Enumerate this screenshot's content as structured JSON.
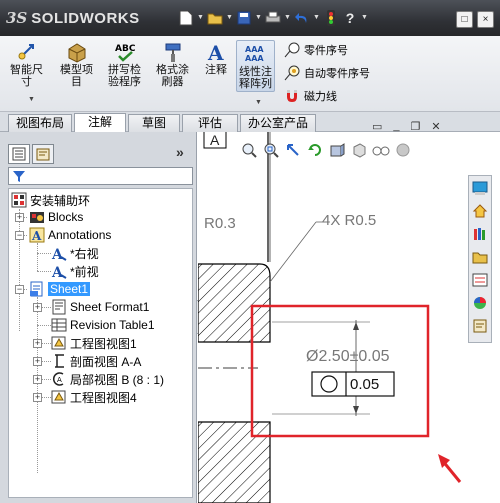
{
  "app": {
    "logo_prefix": "3S",
    "logo_text": "SOLIDWORKS"
  },
  "quick_access": [
    "new-icon",
    "open-icon",
    "save-icon",
    "print-icon",
    "undo-icon",
    "rebuild-icon",
    "help-icon"
  ],
  "window_buttons": [
    "□",
    "×"
  ],
  "ribbon": {
    "smart_dimension": "智能尺\n寸",
    "model_items": "模型项\n目",
    "spell_check": "拼写检\n验程序",
    "format_painter": "格式涂\n刷器",
    "note": "注释",
    "linear_note_pattern": "线性注\n释阵列",
    "balloon": "零件序号",
    "auto_balloon": "自动零件序号",
    "magnetic_line": "磁力线"
  },
  "tabs": [
    "视图布局",
    "注解",
    "草图",
    "评估",
    "办公室产品"
  ],
  "selected_tab": "注解",
  "panel": {
    "chevron": "»",
    "tree": {
      "root": "安装辅助环",
      "blocks": "Blocks",
      "annotations": "Annotations",
      "right_view": "*右视",
      "front_view": "*前视",
      "sheet": "Sheet1",
      "sheet_format": "Sheet Format1",
      "revision_table": "Revision Table1",
      "drawing_view1": "工程图视图1",
      "section_view": "剖面视图 A-A",
      "detail_view": "局部视图 B (8 : 1)",
      "drawing_view4": "工程图视图4"
    }
  },
  "drawing": {
    "label_a": "A",
    "radius_left": "R0.3",
    "radius_note": "4X R0.5",
    "dimension": "Ø2.50±0.05",
    "tolerance_value": "0.05",
    "highlight_color": "#e0242a"
  }
}
